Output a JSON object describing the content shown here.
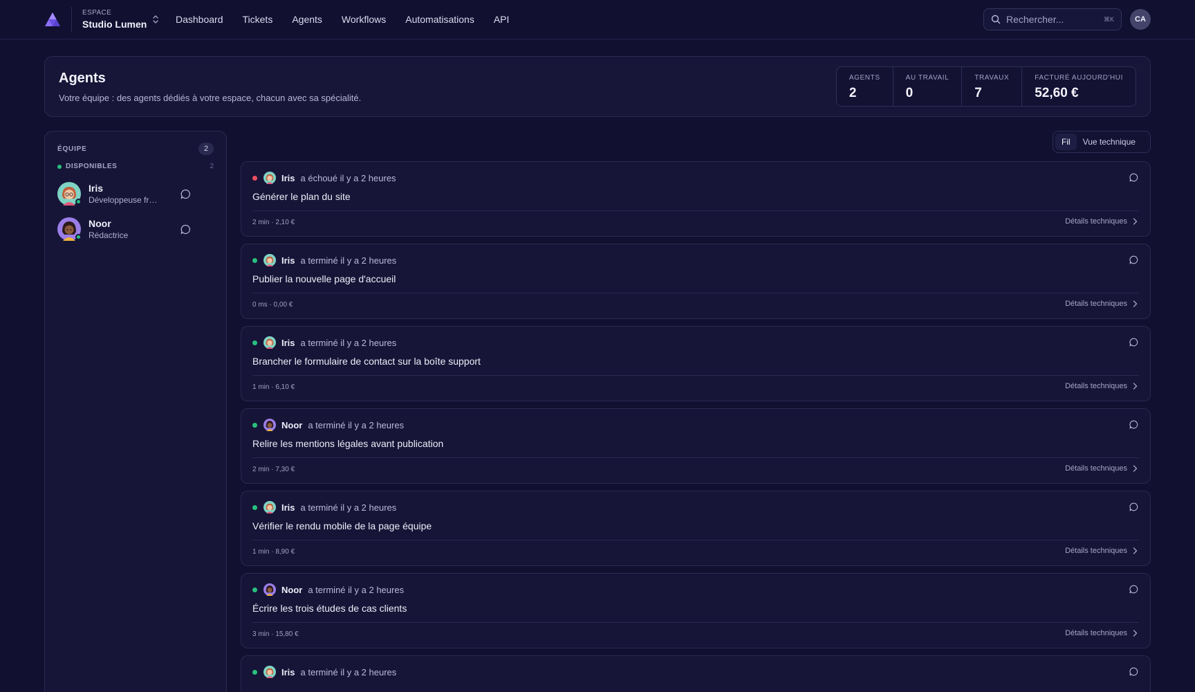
{
  "topbar": {
    "workspace_caption": "ESPACE",
    "workspace_name": "Studio Lumen",
    "nav": [
      "Dashboard",
      "Tickets",
      "Agents",
      "Workflows",
      "Automatisations",
      "API"
    ],
    "search_placeholder": "Rechercher...",
    "search_shortcut": "⌘K",
    "user_initials": "CA"
  },
  "header": {
    "title": "Agents",
    "subtitle": "Votre équipe : des agents dédiés à votre espace, chacun avec sa spécialité.",
    "stats": [
      {
        "label": "AGENTS",
        "value": "2"
      },
      {
        "label": "AU TRAVAIL",
        "value": "0"
      },
      {
        "label": "TRAVAUX",
        "value": "7"
      },
      {
        "label": "FACTURÉ AUJOURD'HUI",
        "value": "52,60 €"
      }
    ]
  },
  "sidebar": {
    "title": "ÉQUIPE",
    "count": "2",
    "group_label": "DISPONIBLES",
    "group_count": "2",
    "agents": [
      {
        "name": "Iris",
        "role": "Développeuse fro...",
        "avatar": "iris-avatar"
      },
      {
        "name": "Noor",
        "role": "Rédactrice",
        "avatar": "noor-avatar"
      }
    ]
  },
  "view_toggle": {
    "options": [
      "Fil",
      "Vue technique"
    ],
    "active": "Fil"
  },
  "jobs": [
    {
      "agent": "Iris",
      "status": "fail",
      "status_text": "a échoué il y a 2 heures",
      "title": "Générer le plan du site",
      "meta": "2 min · 2,10 €",
      "tech_label": "Détails techniques"
    },
    {
      "agent": "Iris",
      "status": "ok",
      "status_text": "a terminé il y a 2 heures",
      "title": "Publier la nouvelle page d'accueil",
      "meta": "0 ms · 0,00 €",
      "tech_label": "Détails techniques"
    },
    {
      "agent": "Iris",
      "status": "ok",
      "status_text": "a terminé il y a 2 heures",
      "title": "Brancher le formulaire de contact sur la boîte support",
      "meta": "1 min · 6,10 €",
      "tech_label": "Détails techniques"
    },
    {
      "agent": "Noor",
      "status": "ok",
      "status_text": "a terminé il y a 2 heures",
      "title": "Relire les mentions légales avant publication",
      "meta": "2 min · 7,30 €",
      "tech_label": "Détails techniques"
    },
    {
      "agent": "Iris",
      "status": "ok",
      "status_text": "a terminé il y a 2 heures",
      "title": "Vérifier le rendu mobile de la page équipe",
      "meta": "1 min · 8,90 €",
      "tech_label": "Détails techniques"
    },
    {
      "agent": "Noor",
      "status": "ok",
      "status_text": "a terminé il y a 2 heures",
      "title": "Écrire les trois études de cas clients",
      "meta": "3 min · 15,80 €",
      "tech_label": "Détails techniques"
    },
    {
      "agent": "Iris",
      "status": "ok",
      "status_text": "a terminé il y a 2 heures",
      "title": "",
      "meta": "",
      "tech_label": ""
    }
  ],
  "colors": {
    "accent": "#7b5cf0",
    "success": "#29c07e",
    "error": "#ee5060",
    "background": "#111030"
  }
}
